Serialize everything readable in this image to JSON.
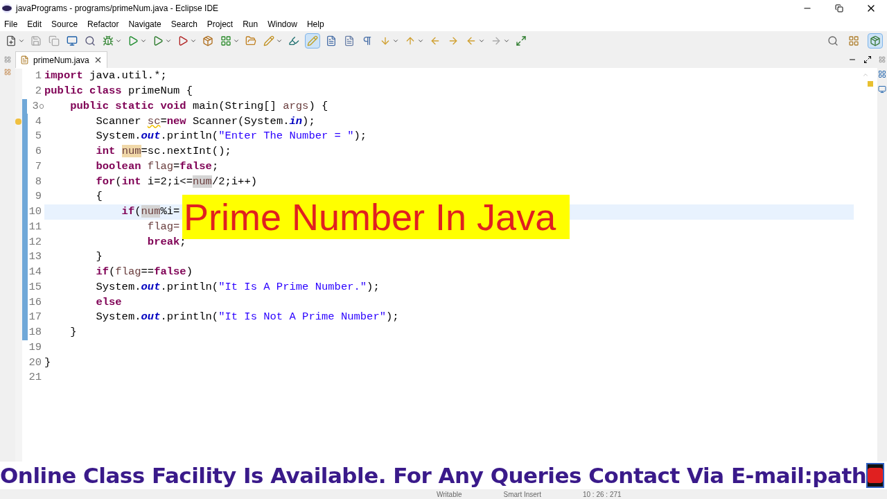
{
  "window": {
    "title": "javaPrograms - programs/primeNum.java - Eclipse IDE"
  },
  "menu": [
    "File",
    "Edit",
    "Source",
    "Refactor",
    "Navigate",
    "Search",
    "Project",
    "Run",
    "Window",
    "Help"
  ],
  "tabs": [
    {
      "label": "primeNum.java",
      "selected": true
    }
  ],
  "editor": {
    "lines": [
      {
        "number": "1",
        "changed": false,
        "current": false,
        "segments": [
          {
            "text": "import",
            "kind": "keyword"
          },
          {
            "text": " java.util.*;",
            "kind": "plain"
          }
        ]
      },
      {
        "number": "2",
        "changed": false,
        "current": false,
        "segments": [
          {
            "text": "public class",
            "kind": "keyword"
          },
          {
            "text": " primeNum {",
            "kind": "plain"
          }
        ]
      },
      {
        "number": "3",
        "changed": true,
        "current": false,
        "fold": true,
        "segments": [
          {
            "text": "    public static void",
            "kind": "keyword"
          },
          {
            "text": " main(String[] ",
            "kind": "plain"
          },
          {
            "text": "args",
            "kind": "local"
          },
          {
            "text": ") {",
            "kind": "plain"
          }
        ]
      },
      {
        "number": "4",
        "changed": true,
        "current": false,
        "warning": true,
        "segments": [
          {
            "text": "        Scanner ",
            "kind": "plain"
          },
          {
            "text": "sc",
            "kind": "warning"
          },
          {
            "text": "=",
            "kind": "plain"
          },
          {
            "text": "new",
            "kind": "keyword"
          },
          {
            "text": " Scanner(System.",
            "kind": "plain"
          },
          {
            "text": "in",
            "kind": "field"
          },
          {
            "text": ");",
            "kind": "plain"
          }
        ]
      },
      {
        "number": "5",
        "changed": true,
        "current": false,
        "segments": [
          {
            "text": "        System.",
            "kind": "plain"
          },
          {
            "text": "out",
            "kind": "field"
          },
          {
            "text": ".println(",
            "kind": "plain"
          },
          {
            "text": "\"Enter The Number = \"",
            "kind": "string"
          },
          {
            "text": ");",
            "kind": "plain"
          }
        ]
      },
      {
        "number": "6",
        "changed": true,
        "current": false,
        "segments": [
          {
            "text": "        int ",
            "kind": "keyword"
          },
          {
            "text": "num",
            "kind": "write-occurrence"
          },
          {
            "text": "=sc.nextInt();",
            "kind": "plain"
          }
        ]
      },
      {
        "number": "7",
        "changed": true,
        "current": false,
        "segments": [
          {
            "text": "        boolean ",
            "kind": "keyword"
          },
          {
            "text": "flag",
            "kind": "local"
          },
          {
            "text": "=",
            "kind": "plain"
          },
          {
            "text": "false",
            "kind": "keyword"
          },
          {
            "text": ";",
            "kind": "plain"
          }
        ]
      },
      {
        "number": "8",
        "changed": true,
        "current": false,
        "segments": [
          {
            "text": "        for",
            "kind": "keyword"
          },
          {
            "text": "(",
            "kind": "plain"
          },
          {
            "text": "int",
            "kind": "keyword"
          },
          {
            "text": " i=2;i<=",
            "kind": "plain"
          },
          {
            "text": "num",
            "kind": "occurrence"
          },
          {
            "text": "/2;i++)",
            "kind": "plain"
          }
        ]
      },
      {
        "number": "9",
        "changed": true,
        "current": false,
        "segments": [
          {
            "text": "        {",
            "kind": "plain"
          }
        ]
      },
      {
        "number": "10",
        "changed": true,
        "current": true,
        "segments": [
          {
            "text": "            if",
            "kind": "keyword"
          },
          {
            "text": "(",
            "kind": "plain"
          },
          {
            "text": "num",
            "kind": "occurrence"
          },
          {
            "text": "%i=",
            "kind": "plain"
          }
        ]
      },
      {
        "number": "11",
        "changed": true,
        "current": false,
        "segments": [
          {
            "text": "                flag=",
            "kind": "local"
          }
        ]
      },
      {
        "number": "12",
        "changed": true,
        "current": false,
        "segments": [
          {
            "text": "                break",
            "kind": "keyword"
          },
          {
            "text": ";",
            "kind": "plain"
          }
        ]
      },
      {
        "number": "13",
        "changed": true,
        "current": false,
        "segments": [
          {
            "text": "        }",
            "kind": "plain"
          }
        ]
      },
      {
        "number": "14",
        "changed": true,
        "current": false,
        "segments": [
          {
            "text": "        if",
            "kind": "keyword"
          },
          {
            "text": "(",
            "kind": "plain"
          },
          {
            "text": "flag",
            "kind": "local"
          },
          {
            "text": "==",
            "kind": "plain"
          },
          {
            "text": "false",
            "kind": "keyword"
          },
          {
            "text": ")",
            "kind": "plain"
          }
        ]
      },
      {
        "number": "15",
        "changed": true,
        "current": false,
        "segments": [
          {
            "text": "        System.",
            "kind": "plain"
          },
          {
            "text": "out",
            "kind": "field"
          },
          {
            "text": ".println(",
            "kind": "plain"
          },
          {
            "text": "\"It Is A Prime Number.\"",
            "kind": "string"
          },
          {
            "text": ");",
            "kind": "plain"
          }
        ]
      },
      {
        "number": "16",
        "changed": true,
        "current": false,
        "segments": [
          {
            "text": "        else",
            "kind": "keyword"
          }
        ]
      },
      {
        "number": "17",
        "changed": true,
        "current": false,
        "segments": [
          {
            "text": "        System.",
            "kind": "plain"
          },
          {
            "text": "out",
            "kind": "field"
          },
          {
            "text": ".println(",
            "kind": "plain"
          },
          {
            "text": "\"It Is Not A Prime Number\"",
            "kind": "string"
          },
          {
            "text": ");",
            "kind": "plain"
          }
        ]
      },
      {
        "number": "18",
        "changed": true,
        "current": false,
        "segments": [
          {
            "text": "    }",
            "kind": "plain"
          }
        ]
      },
      {
        "number": "19",
        "changed": false,
        "current": false
      },
      {
        "number": "20",
        "changed": false,
        "current": false,
        "segments": [
          {
            "text": "}",
            "kind": "plain"
          }
        ]
      },
      {
        "number": "21",
        "changed": false,
        "current": false
      }
    ]
  },
  "banner": "Prime Number In Java",
  "ticker": "Online Class Facility Is Available. For Any Queries Contact Via E-mail:path",
  "status_bar": [
    "Writable",
    "Smart Insert",
    "10 : 26 : 271"
  ]
}
